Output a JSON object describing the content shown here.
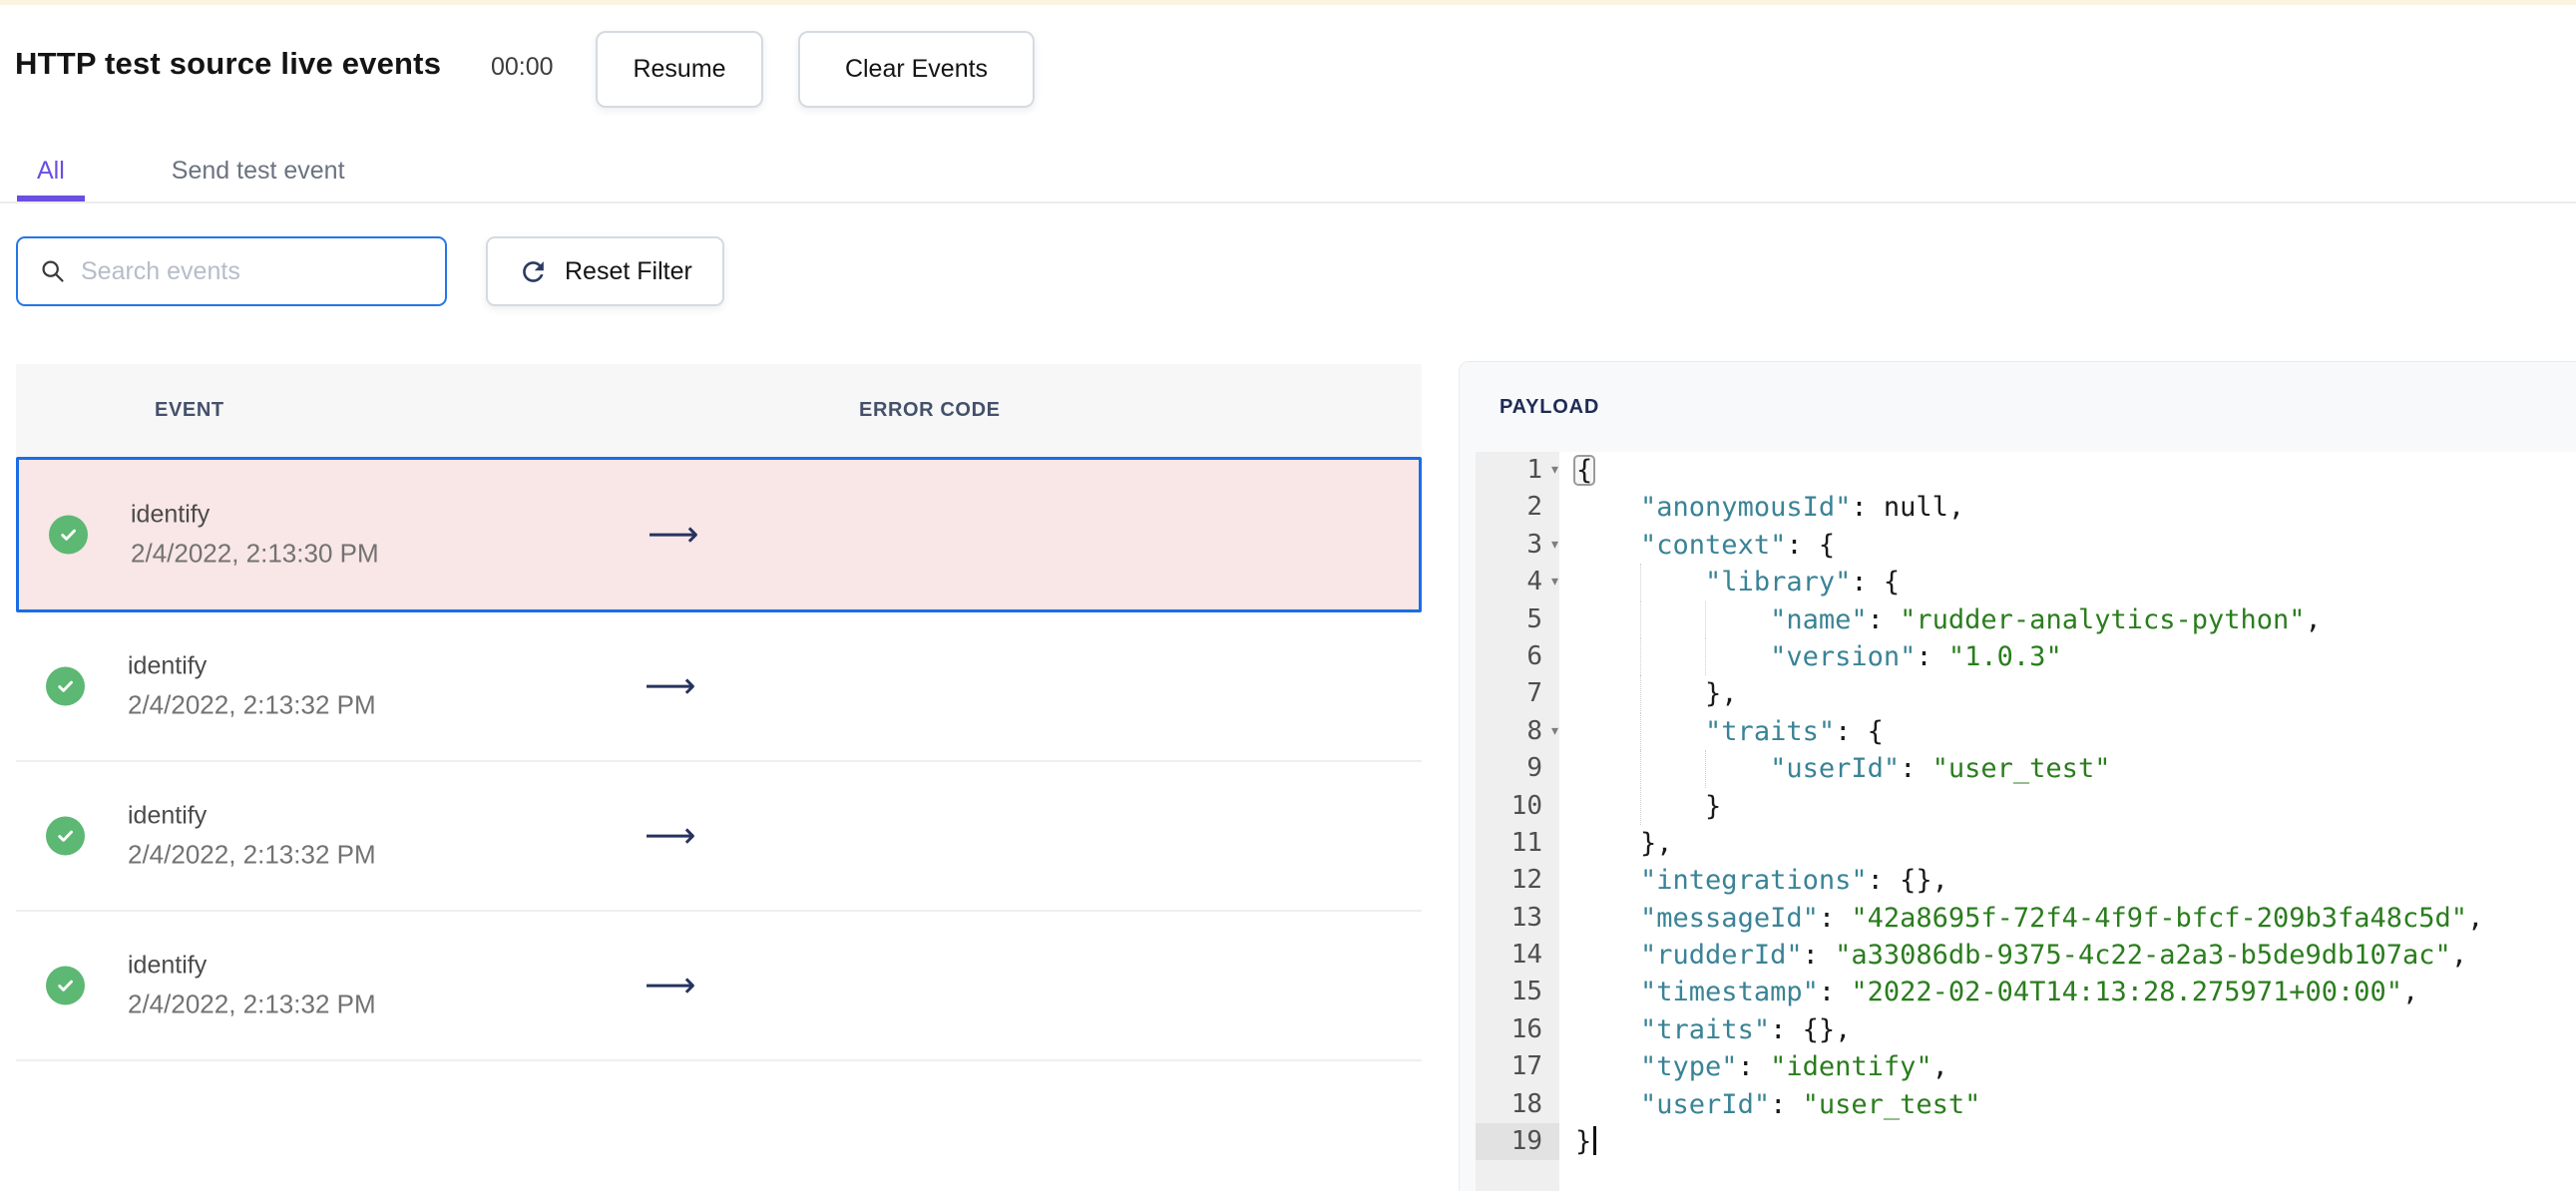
{
  "header": {
    "title": "HTTP test source live events",
    "timer": "00:00",
    "resume_label": "Resume",
    "clear_label": "Clear Events"
  },
  "tabs": {
    "items": [
      {
        "label": "All",
        "active": true
      },
      {
        "label": "Send test event",
        "active": false
      }
    ]
  },
  "filters": {
    "search_placeholder": "Search events",
    "search_value": "",
    "reset_label": "Reset Filter"
  },
  "icons": {
    "search": "magnifier",
    "reset": "refresh-circular-arrow",
    "row_status": "check-circle",
    "row_action": "long-right-arrow"
  },
  "colors": {
    "accent_purple": "#6a4fe1",
    "focus_blue": "#2377e8",
    "selected_row_border": "#1b6ce6",
    "selected_row_bg": "#f9e6e6",
    "success_green": "#5cb873",
    "arrow_navy": "#26335f",
    "json_key": "#3a8396",
    "json_string": "#2a7d1d"
  },
  "events_table": {
    "columns": [
      "EVENT",
      "ERROR CODE"
    ],
    "arrow_glyph": "⟶",
    "rows": [
      {
        "name": "identify",
        "time": "2/4/2022, 2:13:30 PM",
        "status": "success",
        "selected": true
      },
      {
        "name": "identify",
        "time": "2/4/2022, 2:13:32 PM",
        "status": "success",
        "selected": false
      },
      {
        "name": "identify",
        "time": "2/4/2022, 2:13:32 PM",
        "status": "success",
        "selected": false
      },
      {
        "name": "identify",
        "time": "2/4/2022, 2:13:32 PM",
        "status": "success",
        "selected": false
      }
    ]
  },
  "payload": {
    "title": "PAYLOAD",
    "fold_glyph": "▾",
    "lines": [
      {
        "n": 1,
        "fold": true,
        "segs": [
          [
            "{",
            "p",
            "box"
          ]
        ]
      },
      {
        "n": 2,
        "segs": [
          [
            "    ",
            "p"
          ],
          [
            "\"anonymousId\"",
            "k"
          ],
          [
            ": ",
            "p"
          ],
          [
            "null,",
            "p"
          ]
        ]
      },
      {
        "n": 3,
        "fold": true,
        "segs": [
          [
            "    ",
            "p"
          ],
          [
            "\"context\"",
            "k"
          ],
          [
            ": {",
            "p"
          ]
        ]
      },
      {
        "n": 4,
        "fold": true,
        "segs": [
          [
            "        ",
            "p"
          ],
          [
            "\"library\"",
            "k"
          ],
          [
            ": {",
            "p"
          ]
        ]
      },
      {
        "n": 5,
        "segs": [
          [
            "            ",
            "p"
          ],
          [
            "\"name\"",
            "k"
          ],
          [
            ": ",
            "p"
          ],
          [
            "\"rudder-analytics-python\"",
            "s"
          ],
          [
            ",",
            "p"
          ]
        ]
      },
      {
        "n": 6,
        "segs": [
          [
            "            ",
            "p"
          ],
          [
            "\"version\"",
            "k"
          ],
          [
            ": ",
            "p"
          ],
          [
            "\"1.0.3\"",
            "s"
          ]
        ]
      },
      {
        "n": 7,
        "segs": [
          [
            "        },",
            "p"
          ]
        ]
      },
      {
        "n": 8,
        "fold": true,
        "segs": [
          [
            "        ",
            "p"
          ],
          [
            "\"traits\"",
            "k"
          ],
          [
            ": {",
            "p"
          ]
        ]
      },
      {
        "n": 9,
        "segs": [
          [
            "            ",
            "p"
          ],
          [
            "\"userId\"",
            "k"
          ],
          [
            ": ",
            "p"
          ],
          [
            "\"user_test\"",
            "s"
          ]
        ]
      },
      {
        "n": 10,
        "segs": [
          [
            "        }",
            "p"
          ]
        ]
      },
      {
        "n": 11,
        "segs": [
          [
            "    },",
            "p"
          ]
        ]
      },
      {
        "n": 12,
        "segs": [
          [
            "    ",
            "p"
          ],
          [
            "\"integrations\"",
            "k"
          ],
          [
            ": {},",
            "p"
          ]
        ]
      },
      {
        "n": 13,
        "segs": [
          [
            "    ",
            "p"
          ],
          [
            "\"messageId\"",
            "k"
          ],
          [
            ": ",
            "p"
          ],
          [
            "\"42a8695f-72f4-4f9f-bfcf-209b3fa48c5d\"",
            "s"
          ],
          [
            ",",
            "p"
          ]
        ]
      },
      {
        "n": 14,
        "segs": [
          [
            "    ",
            "p"
          ],
          [
            "\"rudderId\"",
            "k"
          ],
          [
            ": ",
            "p"
          ],
          [
            "\"a33086db-9375-4c22-a2a3-b5de9db107ac\"",
            "s"
          ],
          [
            ",",
            "p"
          ]
        ]
      },
      {
        "n": 15,
        "segs": [
          [
            "    ",
            "p"
          ],
          [
            "\"timestamp\"",
            "k"
          ],
          [
            ": ",
            "p"
          ],
          [
            "\"2022-02-04T14:13:28.275971+00:00\"",
            "s"
          ],
          [
            ",",
            "p"
          ]
        ]
      },
      {
        "n": 16,
        "segs": [
          [
            "    ",
            "p"
          ],
          [
            "\"traits\"",
            "k"
          ],
          [
            ": {},",
            "p"
          ]
        ]
      },
      {
        "n": 17,
        "segs": [
          [
            "    ",
            "p"
          ],
          [
            "\"type\"",
            "k"
          ],
          [
            ": ",
            "p"
          ],
          [
            "\"identify\"",
            "s"
          ],
          [
            ",",
            "p"
          ]
        ]
      },
      {
        "n": 18,
        "segs": [
          [
            "    ",
            "p"
          ],
          [
            "\"userId\"",
            "k"
          ],
          [
            ": ",
            "p"
          ],
          [
            "\"user_test\"",
            "s"
          ]
        ]
      },
      {
        "n": 19,
        "active": true,
        "cursor": true,
        "segs": [
          [
            "}",
            "p"
          ]
        ]
      }
    ]
  }
}
